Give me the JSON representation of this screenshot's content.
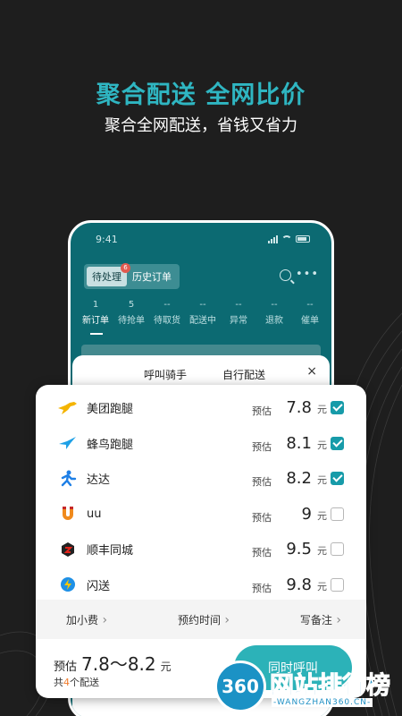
{
  "hero": {
    "title": "聚合配送 全网比价",
    "subtitle": "聚合全网配送，省钱又省力"
  },
  "phone": {
    "time": "9:41",
    "tabs": [
      "待处理",
      "历史订单"
    ],
    "badge": "6",
    "status_tabs": [
      {
        "count": "1",
        "label": "新订单"
      },
      {
        "count": "5",
        "label": "待抢单"
      },
      {
        "count": "--",
        "label": "待取货"
      },
      {
        "count": "--",
        "label": "配送中"
      },
      {
        "count": "--",
        "label": "异常"
      },
      {
        "count": "--",
        "label": "退款"
      },
      {
        "count": "--",
        "label": "催单"
      }
    ],
    "sheet_tabs": [
      "呼叫骑手",
      "自行配送"
    ],
    "close": "×"
  },
  "providers": [
    {
      "name": "美团跑腿",
      "est": "预估",
      "price": "7.8",
      "unit": "元",
      "checked": true,
      "icon": "meituan-kangaroo-icon",
      "color": "#f4b400"
    },
    {
      "name": "蜂鸟跑腿",
      "est": "预估",
      "price": "8.1",
      "unit": "元",
      "checked": true,
      "icon": "fengniao-bird-icon",
      "color": "#1ea0e6"
    },
    {
      "name": "达达",
      "est": "预估",
      "price": "8.2",
      "unit": "元",
      "checked": true,
      "icon": "dada-runner-icon",
      "color": "#1e7fe6"
    },
    {
      "name": "uu",
      "est": "预估",
      "price": "9",
      "unit": "元",
      "checked": false,
      "icon": "uu-magnet-icon",
      "color": "#f08a1c"
    },
    {
      "name": "顺丰同城",
      "est": "预估",
      "price": "9.5",
      "unit": "元",
      "checked": false,
      "icon": "shunfeng-logo-icon",
      "color": "#e2231a"
    },
    {
      "name": "闪送",
      "est": "预估",
      "price": "9.8",
      "unit": "元",
      "checked": false,
      "icon": "shansong-bolt-icon",
      "color": "#1e90e6"
    }
  ],
  "options": [
    "加小费",
    "预约时间",
    "写备注"
  ],
  "footer": {
    "est_label": "预估",
    "range": "7.8～8.2",
    "unit": "元",
    "count_prefix": "共",
    "count": "4",
    "count_suffix": "个配送",
    "call_button": "同时呼叫"
  },
  "watermark": {
    "logo": "360",
    "text": "网站排行榜",
    "url": "-WANGZHAN360.CN-"
  }
}
